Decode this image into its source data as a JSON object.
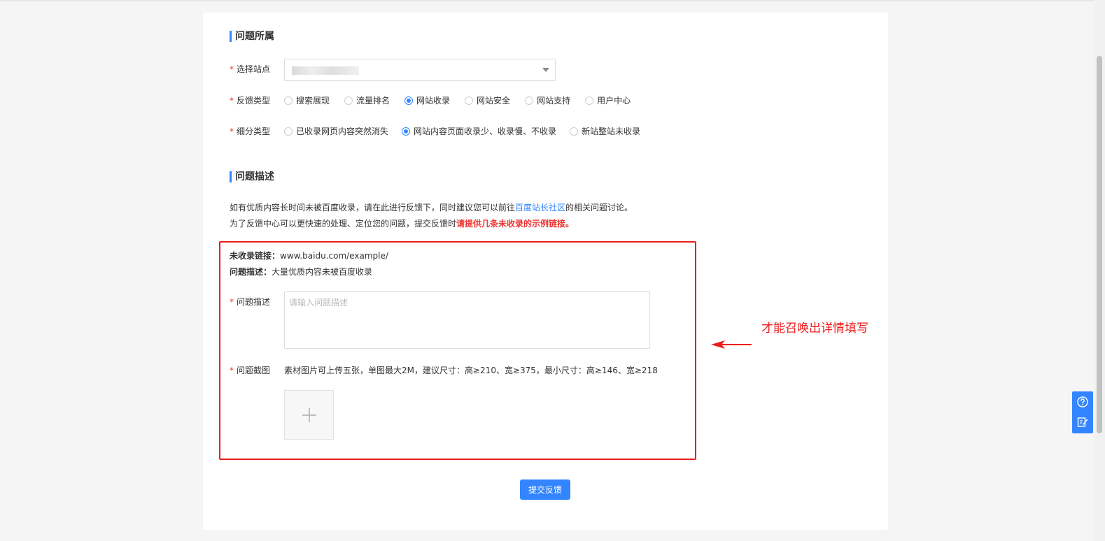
{
  "section1": {
    "title": "问题所属"
  },
  "site": {
    "label": "选择站点",
    "required": "*"
  },
  "feedback_type": {
    "label": "反馈类型",
    "required": "*",
    "options": [
      "搜索展现",
      "流量排名",
      "网站收录",
      "网站安全",
      "网站支持",
      "用户中心"
    ],
    "selected": "网站收录"
  },
  "sub_type": {
    "label": "细分类型",
    "required": "*",
    "options": [
      "已收录网页内容突然消失",
      "网站内容页面收录少、收录慢、不收录",
      "新站整站未收录"
    ],
    "selected": "网站内容页面收录少、收录慢、不收录"
  },
  "section2": {
    "title": "问题描述"
  },
  "intro": {
    "line1_prefix": "如有优质内容长时间未被百度收录，请在此进行反馈下，同时建议您可以前往",
    "line1_link": "百度站长社区",
    "line1_suffix": "的相关问题讨论。",
    "line2_prefix": "为了反馈中心可以更快速的处理、定位您的问题，提交反馈时",
    "line2_warning": "请提供几条未收录的示例链接。"
  },
  "example": {
    "link_label": "未收录链接：",
    "link_value": "www.baidu.com/example/",
    "desc_label": "问题描述：",
    "desc_value": "大量优质内容未被百度收录"
  },
  "problem_desc": {
    "label": "问题描述",
    "required": "*",
    "placeholder": "请输入问题描述"
  },
  "screenshot": {
    "label": "问题截图",
    "required": "*",
    "hint": "素材图片可上传五张，单图最大2M，建议尺寸：高≥210、宽≥375，最小尺寸：高≥146、宽≥218"
  },
  "submit": {
    "label": "提交反馈"
  },
  "annotation": {
    "text": "才能召唤出详情填写"
  },
  "side_tools": {
    "icons": [
      "help-icon",
      "feedback-edit-icon"
    ]
  },
  "colors": {
    "accent": "#3385ff",
    "required_star": "#e33333",
    "annotation": "#ee1c1c"
  }
}
